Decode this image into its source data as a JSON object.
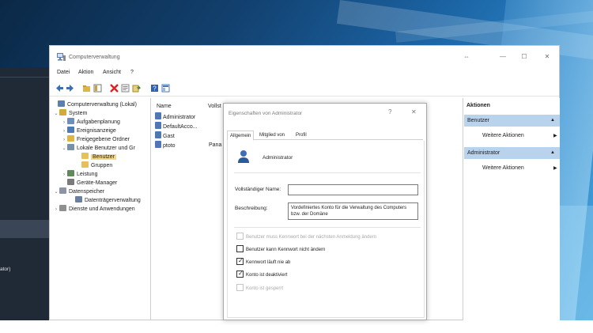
{
  "window": {
    "title": "Computerverwaltung",
    "controls": {
      "pin": "⇔",
      "minimize": "—",
      "maximize": "☐",
      "close": "✕"
    }
  },
  "menu": {
    "items": [
      "Datei",
      "Aktion",
      "Ansicht",
      "?"
    ]
  },
  "toolbar": {
    "icons": [
      "back-arrow-icon",
      "forward-arrow-icon",
      "up-folder-icon",
      "show-hide-tree-icon",
      "delete-icon",
      "properties-icon",
      "export-list-icon",
      "help-icon",
      "mmc-icon"
    ]
  },
  "tree": {
    "items": [
      {
        "label": "Computerverwaltung (Lokal)",
        "exp": "",
        "icon": "computer-management-icon",
        "color": "#5a7fb0"
      },
      {
        "label": "System",
        "exp": "⌄",
        "icon": "system-tools-icon",
        "color": "#d4a93a"
      },
      {
        "label": "Aufgabenplanung",
        "exp": "›",
        "icon": "task-scheduler-icon",
        "color": "#6e8fb7"
      },
      {
        "label": "Ereignisanzeige",
        "exp": "›",
        "icon": "event-viewer-icon",
        "color": "#4c7bb5"
      },
      {
        "label": "Freigegebene Ordner",
        "exp": "›",
        "icon": "shared-folders-icon",
        "color": "#e0b546"
      },
      {
        "label": "Lokale Benutzer und Gr",
        "exp": "⌄",
        "icon": "local-users-groups-icon",
        "color": "#7a8fa8"
      },
      {
        "label": "Benutzer",
        "exp": "",
        "icon": "users-folder-icon",
        "color": "#e6c05a",
        "selected": true
      },
      {
        "label": "Gruppen",
        "exp": "",
        "icon": "groups-folder-icon",
        "color": "#e6c05a"
      },
      {
        "label": "Leistung",
        "exp": "›",
        "icon": "performance-icon",
        "color": "#5f8a5a"
      },
      {
        "label": "Geräte-Manager",
        "exp": "",
        "icon": "device-manager-icon",
        "color": "#7a7a7a"
      },
      {
        "label": "Datenspeicher",
        "exp": "⌄",
        "icon": "storage-icon",
        "color": "#8a94a3"
      },
      {
        "label": "Datenträgerverwaltung",
        "exp": "",
        "icon": "disk-management-icon",
        "color": "#6a7fa0"
      },
      {
        "label": "Dienste und Anwendungen",
        "exp": "›",
        "icon": "services-applications-icon",
        "color": "#8f8f8f"
      }
    ]
  },
  "list": {
    "columns": [
      "Name",
      "Vollst"
    ],
    "rows": [
      {
        "name": "Administrator",
        "fullname": ""
      },
      {
        "name": "DefaultAcco...",
        "fullname": ""
      },
      {
        "name": "Gast",
        "fullname": ""
      },
      {
        "name": "ptoto",
        "fullname": "Pana"
      }
    ]
  },
  "actions": {
    "title": "Aktionen",
    "sections": [
      {
        "label": "Benutzer",
        "arrow": "▲",
        "item": "Weitere Aktionen",
        "item_arrow": "▶"
      },
      {
        "label": "Administrator",
        "arrow": "▲",
        "item": "Weitere Aktionen",
        "item_arrow": "▶"
      }
    ]
  },
  "dialog": {
    "title": "Eigenschaften von Administrator",
    "help": "?",
    "close": "✕",
    "tabs": [
      "Allgemein",
      "Mitglied von",
      "Profil"
    ],
    "user_name": "Administrator",
    "fullname_label": "Vollständiger Name:",
    "fullname_value": "",
    "description_label": "Beschreibung:",
    "description_value": "Vordefiniertes Konto für die Verwaltung des Computers bzw. der Domäne",
    "checkboxes": [
      {
        "label": "Benutzer muss Kennwort bei der nächsten Anmeldung ändern",
        "checked": false,
        "disabled": true
      },
      {
        "label": "Benutzer kann Kennwort nicht ändern",
        "checked": false,
        "disabled": false
      },
      {
        "label": "Kennwort läuft nie ab",
        "checked": true,
        "disabled": false
      },
      {
        "label": "Konto ist deaktiviert",
        "checked": true,
        "disabled": false
      },
      {
        "label": "Konto ist gesperrt",
        "checked": false,
        "disabled": true
      }
    ]
  },
  "background": {
    "left_panel_fragment": "ator)"
  },
  "colors": {
    "actions_section_bg": "#b9d3ec",
    "selected_tree_bg": "#f3d88a",
    "desktop_blue": "#1b63a3",
    "sidebar_dark": "#1f2a36"
  }
}
